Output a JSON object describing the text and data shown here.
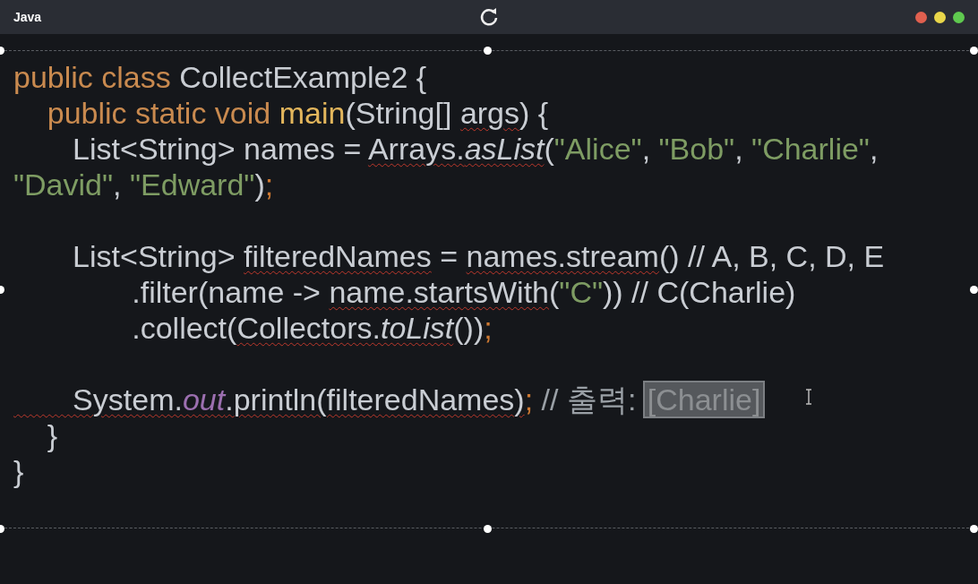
{
  "window": {
    "title": "Java"
  },
  "code_lines": [
    {
      "space_before": false,
      "tokens": [
        {
          "text": "public class ",
          "kind": "keyword",
          "squiggle": false
        },
        {
          "text": "CollectExample2 {",
          "kind": "plain",
          "squiggle": false
        }
      ]
    },
    {
      "space_before": false,
      "tokens": [
        {
          "text": "    public static void ",
          "kind": "keyword",
          "squiggle": false
        },
        {
          "text": "main",
          "kind": "method",
          "squiggle": false
        },
        {
          "text": "(String[] ",
          "kind": "plain",
          "squiggle": false
        },
        {
          "text": "args",
          "kind": "plain",
          "squiggle": true
        },
        {
          "text": ") {",
          "kind": "plain",
          "squiggle": false
        }
      ]
    },
    {
      "space_before": false,
      "tokens": [
        {
          "text": "       List<String> names = ",
          "kind": "plain",
          "squiggle": false
        },
        {
          "text": "Arrays.",
          "kind": "plain",
          "squiggle": true
        },
        {
          "text": "asList",
          "kind": "static",
          "squiggle": true
        },
        {
          "text": "(",
          "kind": "plain",
          "squiggle": false
        },
        {
          "text": "\"Alice\"",
          "kind": "string",
          "squiggle": false
        },
        {
          "text": ", ",
          "kind": "plain",
          "squiggle": false
        },
        {
          "text": "\"Bob\"",
          "kind": "string",
          "squiggle": false
        },
        {
          "text": ", ",
          "kind": "plain",
          "squiggle": false
        },
        {
          "text": "\"Charlie\"",
          "kind": "string",
          "squiggle": false
        },
        {
          "text": ",",
          "kind": "plain",
          "squiggle": false
        }
      ]
    },
    {
      "space_before": false,
      "tokens": [
        {
          "text": "\"David\"",
          "kind": "string",
          "squiggle": false
        },
        {
          "text": ", ",
          "kind": "plain",
          "squiggle": false
        },
        {
          "text": "\"Edward\"",
          "kind": "string",
          "squiggle": false
        },
        {
          "text": ")",
          "kind": "plain",
          "squiggle": false
        },
        {
          "text": ";",
          "kind": "semicolon",
          "squiggle": false
        }
      ]
    },
    {
      "space_before": true,
      "tokens": [
        {
          "text": "       List<String> ",
          "kind": "plain",
          "squiggle": false
        },
        {
          "text": "filteredNames",
          "kind": "plain",
          "squiggle": true
        },
        {
          "text": " = ",
          "kind": "plain",
          "squiggle": false
        },
        {
          "text": "names.stream",
          "kind": "plain",
          "squiggle": true
        },
        {
          "text": "() // A, B, C, D, E",
          "kind": "plain",
          "squiggle": false
        }
      ]
    },
    {
      "space_before": false,
      "tokens": [
        {
          "text": "              .filter(name -> ",
          "kind": "plain",
          "squiggle": false
        },
        {
          "text": "name.startsWith",
          "kind": "plain",
          "squiggle": true
        },
        {
          "text": "(",
          "kind": "plain",
          "squiggle": false
        },
        {
          "text": "\"C\"",
          "kind": "string",
          "squiggle": false
        },
        {
          "text": ")) // C(Charlie)",
          "kind": "plain",
          "squiggle": false
        }
      ]
    },
    {
      "space_before": false,
      "tokens": [
        {
          "text": "              .collect(",
          "kind": "plain",
          "squiggle": false
        },
        {
          "text": "Collectors.",
          "kind": "plain",
          "squiggle": true
        },
        {
          "text": "toList",
          "kind": "static",
          "squiggle": true
        },
        {
          "text": "())",
          "kind": "plain",
          "squiggle": false
        },
        {
          "text": ";",
          "kind": "semicolon",
          "squiggle": false
        }
      ]
    },
    {
      "space_before": true,
      "tokens": [
        {
          "text": "       System.",
          "kind": "plain",
          "squiggle": true
        },
        {
          "text": "out",
          "kind": "field",
          "squiggle": true
        },
        {
          "text": ".println(filteredNames)",
          "kind": "plain",
          "squiggle": true
        },
        {
          "text": ";",
          "kind": "semicolon",
          "squiggle": false
        },
        {
          "text": " // 출력: ",
          "kind": "comment",
          "squiggle": false
        },
        {
          "text": "[Charlie]",
          "kind": "selection",
          "squiggle": false
        }
      ]
    },
    {
      "space_before": false,
      "tokens": [
        {
          "text": "    }",
          "kind": "plain",
          "squiggle": false
        }
      ]
    },
    {
      "space_before": false,
      "tokens": [
        {
          "text": "}",
          "kind": "plain",
          "squiggle": false
        }
      ]
    }
  ]
}
